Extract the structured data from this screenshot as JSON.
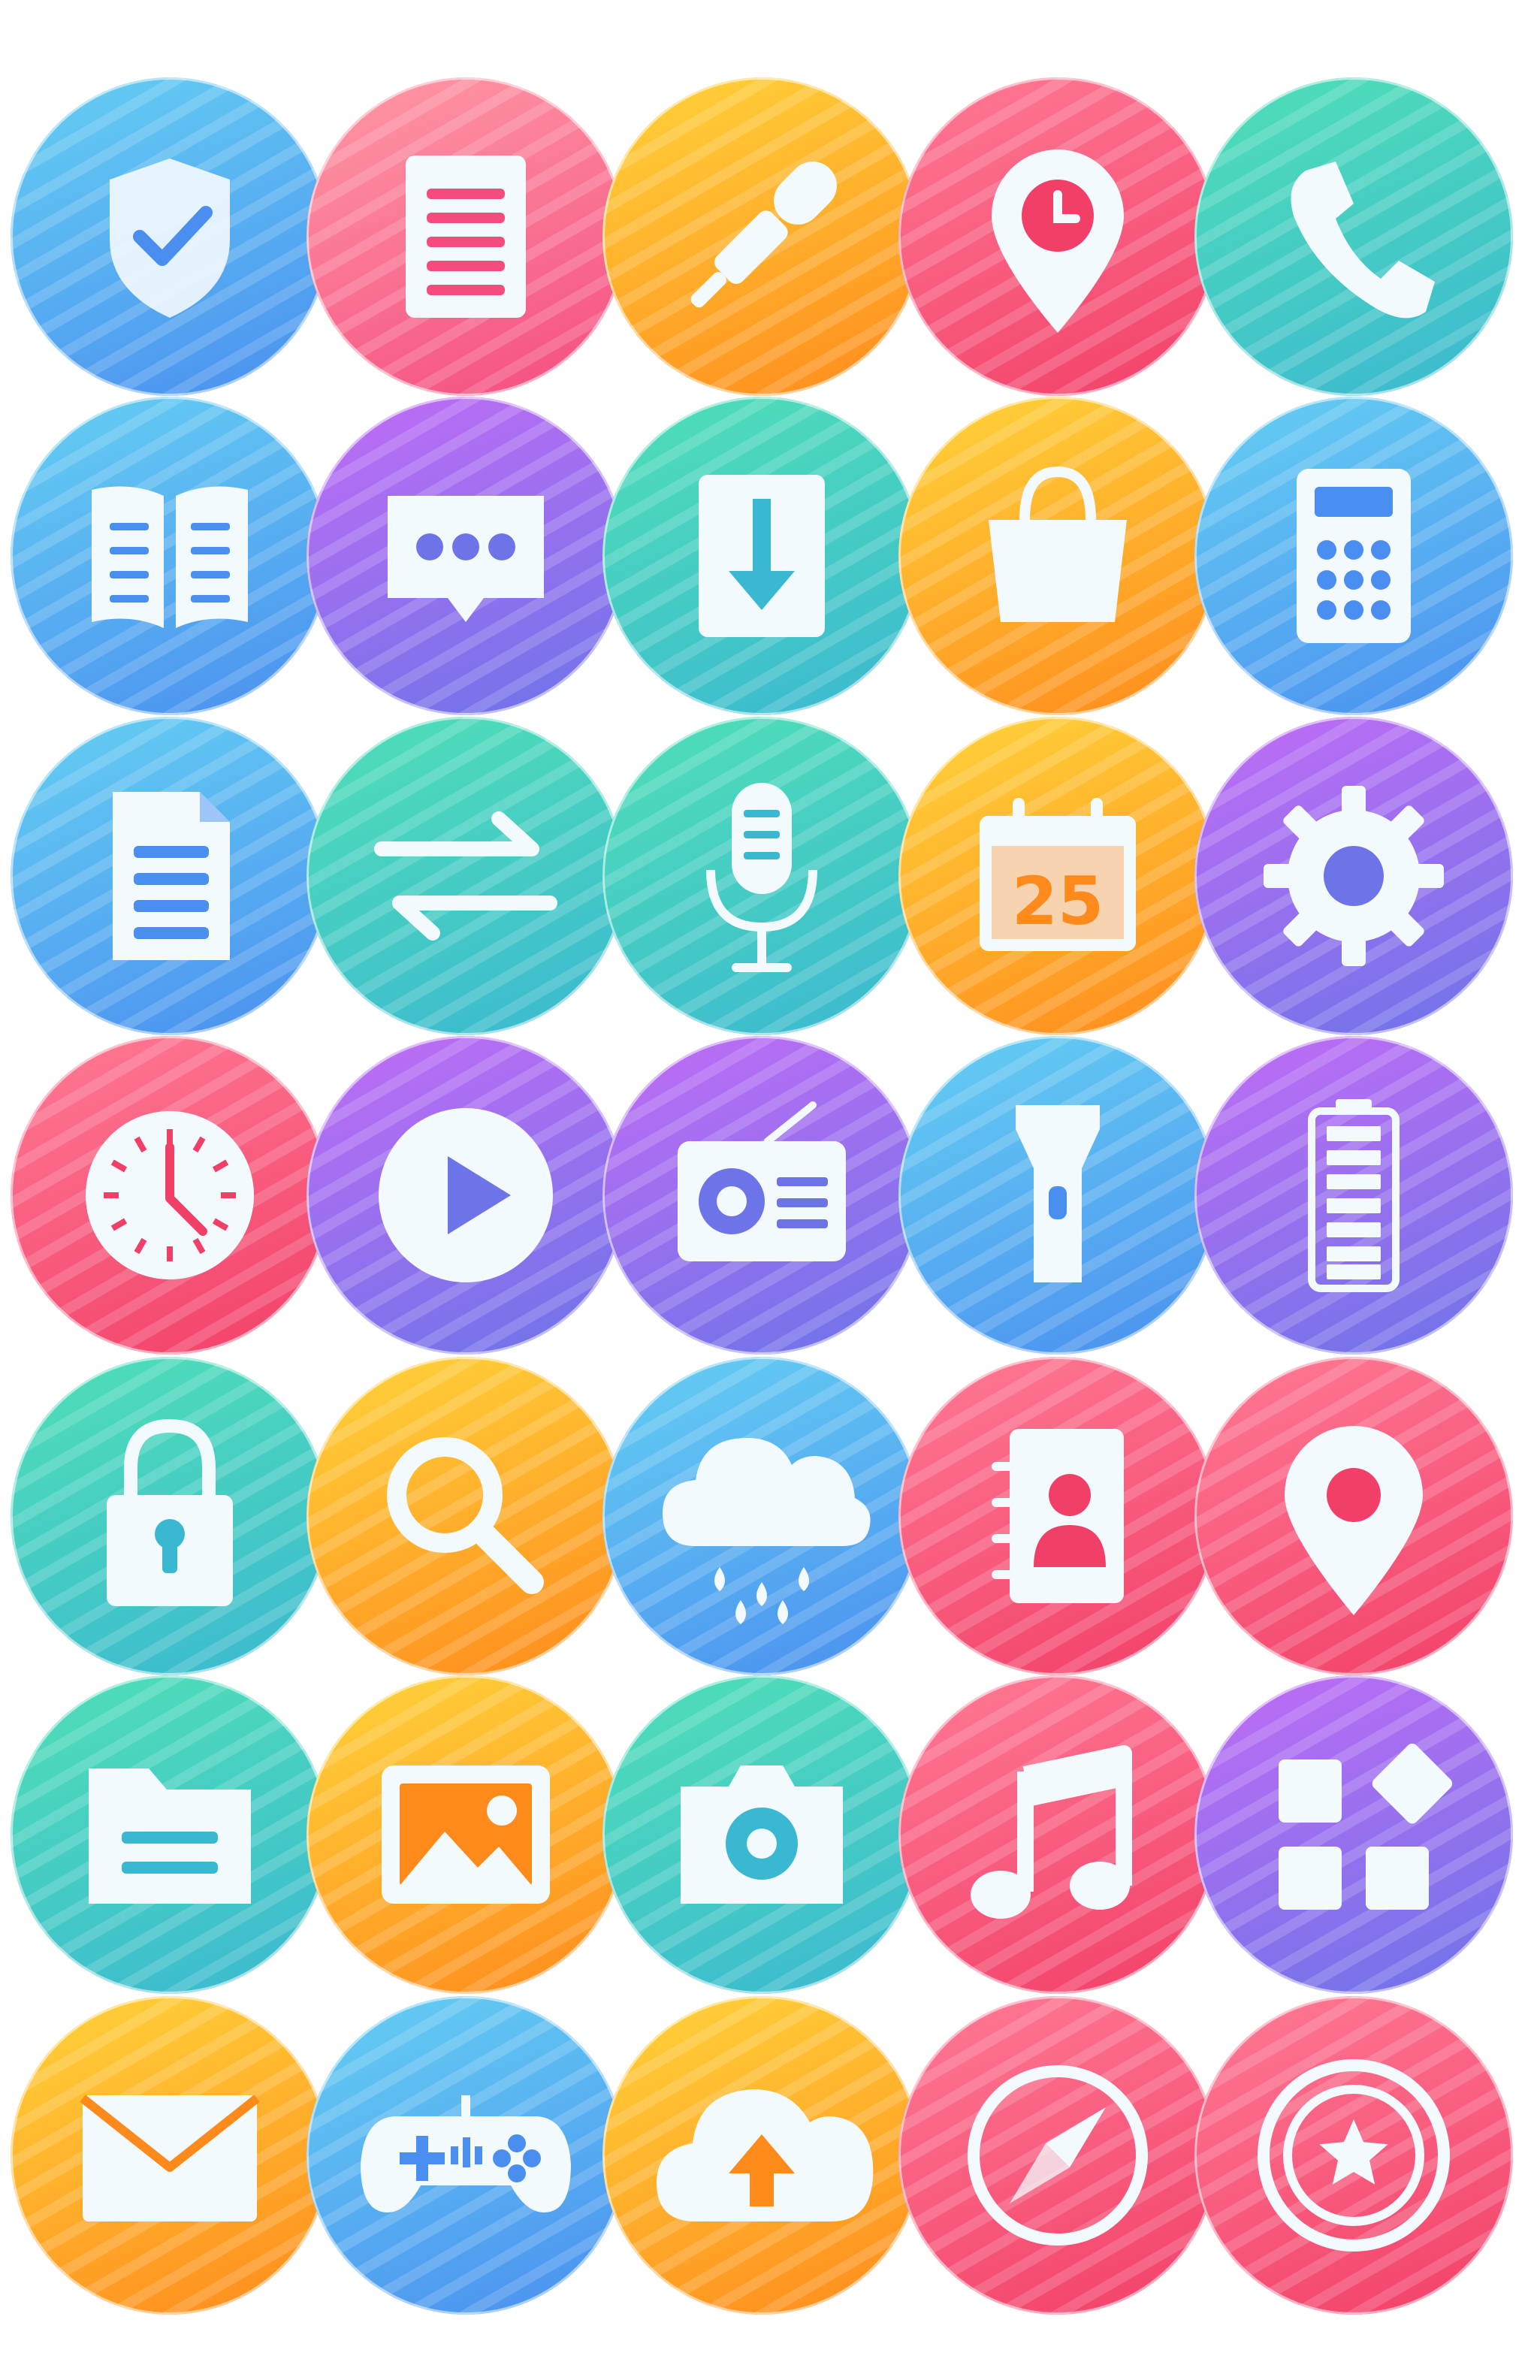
{
  "palette": {
    "blue": [
      "#65d0f2",
      "#4a8ff0"
    ],
    "pink": [
      "#ff9aa6",
      "#f44c7f"
    ],
    "orange": [
      "#ffd43a",
      "#ff8a1c"
    ],
    "red": [
      "#ff7a95",
      "#f23f68"
    ],
    "teal": [
      "#4fe0b6",
      "#3bb8d1"
    ],
    "purple": [
      "#c16cf5",
      "#6c74e8"
    ]
  },
  "icon_fill": "#f3fafe",
  "icons": [
    {
      "name": "shield-check-icon",
      "color": "blue"
    },
    {
      "name": "document-list-icon",
      "color": "pink"
    },
    {
      "name": "microphone-icon",
      "color": "orange"
    },
    {
      "name": "location-time-icon",
      "color": "red"
    },
    {
      "name": "phone-icon",
      "color": "teal"
    },
    {
      "name": "book-icon",
      "color": "blue"
    },
    {
      "name": "chat-bubble-icon",
      "color": "purple"
    },
    {
      "name": "download-icon",
      "color": "teal"
    },
    {
      "name": "shopping-bag-icon",
      "color": "orange"
    },
    {
      "name": "calculator-icon",
      "color": "blue"
    },
    {
      "name": "file-icon",
      "color": "blue"
    },
    {
      "name": "transfer-arrows-icon",
      "color": "teal"
    },
    {
      "name": "studio-mic-icon",
      "color": "teal"
    },
    {
      "name": "calendar-icon",
      "color": "orange"
    },
    {
      "name": "gear-icon",
      "color": "purple"
    },
    {
      "name": "clock-icon",
      "color": "red"
    },
    {
      "name": "play-icon",
      "color": "purple"
    },
    {
      "name": "radio-icon",
      "color": "purple"
    },
    {
      "name": "flashlight-icon",
      "color": "blue"
    },
    {
      "name": "battery-icon",
      "color": "purple"
    },
    {
      "name": "lock-icon",
      "color": "teal"
    },
    {
      "name": "search-icon",
      "color": "orange"
    },
    {
      "name": "rain-cloud-icon",
      "color": "blue"
    },
    {
      "name": "contacts-book-icon",
      "color": "red"
    },
    {
      "name": "location-pin-icon",
      "color": "red"
    },
    {
      "name": "folder-icon",
      "color": "teal"
    },
    {
      "name": "image-icon",
      "color": "orange"
    },
    {
      "name": "camera-icon",
      "color": "teal"
    },
    {
      "name": "music-note-icon",
      "color": "red"
    },
    {
      "name": "apps-grid-icon",
      "color": "purple"
    },
    {
      "name": "mail-icon",
      "color": "orange"
    },
    {
      "name": "gamepad-icon",
      "color": "blue"
    },
    {
      "name": "cloud-upload-icon",
      "color": "orange"
    },
    {
      "name": "compass-icon",
      "color": "red"
    },
    {
      "name": "star-badge-icon",
      "color": "red"
    }
  ],
  "calendar_day": "25"
}
